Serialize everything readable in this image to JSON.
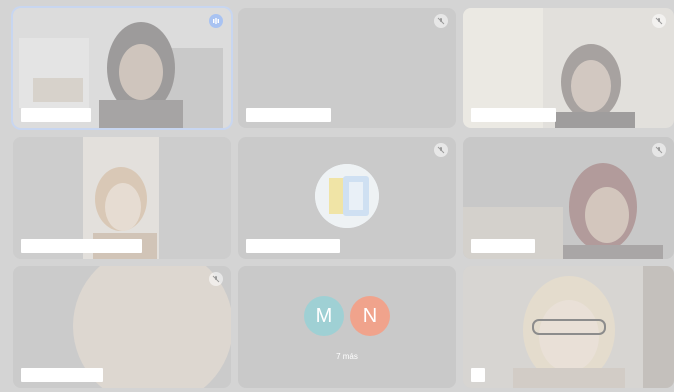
{
  "meeting": {
    "more_participants_label": "7 más",
    "overflow_initials": [
      "M",
      "N"
    ],
    "colors": {
      "accent_speaking": "#a9c3f2",
      "initial_m": "#9fd0d4",
      "initial_n": "#f0a38c"
    }
  },
  "tiles": [
    {
      "name": "",
      "status_icon": "speaking-icon"
    },
    {
      "name": "",
      "status_icon": "mic-off-icon"
    },
    {
      "name": "",
      "status_icon": "mic-off-icon"
    },
    {
      "name": "",
      "status_icon": "none"
    },
    {
      "name": "",
      "status_icon": "mic-off-icon"
    },
    {
      "name": "",
      "status_icon": "mic-off-icon"
    },
    {
      "name": "",
      "status_icon": "mic-off-icon"
    },
    {
      "name": "",
      "status_icon": "none"
    },
    {
      "name": "",
      "status_icon": "none"
    }
  ]
}
